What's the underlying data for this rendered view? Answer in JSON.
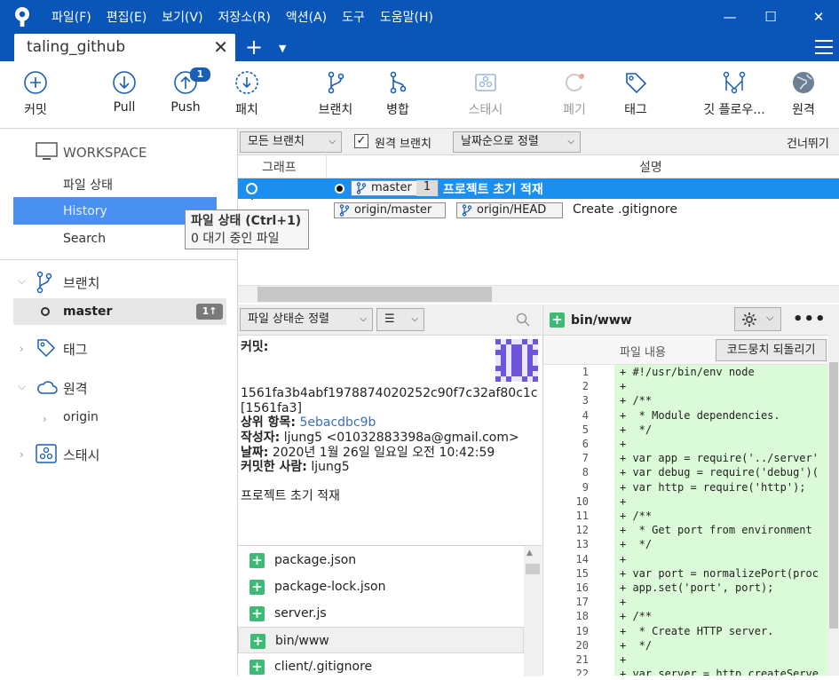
{
  "window": {
    "menu": [
      "파일(F)",
      "편집(E)",
      "보기(V)",
      "저장소(R)",
      "액션(A)",
      "도구",
      "도움말(H)"
    ],
    "controls": {
      "minimize": "—",
      "maximize": "☐",
      "close": "✕"
    }
  },
  "tabs": {
    "active": "taling_github",
    "close": "✕",
    "add": "+",
    "dropdown": "▼"
  },
  "toolbar": {
    "commit": "커밋",
    "pull": "Pull",
    "push": "Push",
    "push_badge": "1",
    "patch": "패치",
    "branch": "브랜치",
    "merge": "병합",
    "stash": "스태시",
    "discard": "폐기",
    "tag": "태그",
    "gitflow": "깃 플로우...",
    "remote": "원격"
  },
  "sidebar": {
    "workspace": "WORKSPACE",
    "workspace_items": [
      "파일 상태",
      "History",
      "Search"
    ],
    "branches_header": "브랜치",
    "branch": "master",
    "branch_ahead": "1↑",
    "tags_header": "태그",
    "remotes_header": "원격",
    "remote": "origin",
    "stash_header": "스태시"
  },
  "tooltip": {
    "title": "파일 상태 (Ctrl+1)",
    "body": "0 대기 중인 파일"
  },
  "history": {
    "filter_branches": "모든 브랜치",
    "remote_branches": "원격 브랜치",
    "remote_branches_checked": true,
    "sort": "날짜순으로 정렬",
    "skip": "건너뛰기",
    "col_graph": "그래프",
    "col_desc": "설명",
    "rows": [
      {
        "refs": [
          "master"
        ],
        "ahead": "1",
        "desc": "프로젝트 초기 적재"
      },
      {
        "refs": [
          "origin/master",
          "origin/HEAD"
        ],
        "desc": "Create .gitignore"
      }
    ]
  },
  "detail": {
    "sort": "파일 상태순 정렬",
    "list_mode": "☰",
    "commit_label": "커밋:",
    "hash": "1561fa3b4abf1978874020252c90f7c32af80c1c",
    "short_hash": "[1561fa3]",
    "parent_label": "상위 항목:",
    "parent": "5ebacdbc9b",
    "author_label": "작성자:",
    "author": "ljung5 <01032883398a@gmail.com>",
    "date_label": "날짜:",
    "date": "2020년 1월 26일 일요일 오전 10:42:59",
    "committer_label": "커밋한 사람:",
    "committer": "ljung5",
    "message": "프로젝트 초기 적재",
    "files": [
      "package.json",
      "package-lock.json",
      "server.js",
      "bin/www",
      "client/.gitignore"
    ]
  },
  "diff": {
    "file": "bin/www",
    "content_label": "파일 내용",
    "revert_hunk": "코드뭉치 되돌리기",
    "lines": [
      "+ #!/usr/bin/env node",
      "+",
      "+ /**",
      "+  * Module dependencies.",
      "+  */",
      "+",
      "+ var app = require('../server'",
      "+ var debug = require('debug')(",
      "+ var http = require('http');",
      "+",
      "+ /**",
      "+  * Get port from environment",
      "+  */",
      "+",
      "+ var port = normalizePort(proc",
      "+ app.set('port', port);",
      "+",
      "+ /**",
      "+  * Create HTTP server.",
      "+  */",
      "+",
      "+ var server = http.createServe"
    ],
    "line_numbers": [
      "1",
      "2",
      "3",
      "4",
      "5",
      "6",
      "7",
      "8",
      "9",
      "10",
      "11",
      "12",
      "13",
      "14",
      "15",
      "16",
      "17",
      "18",
      "19",
      "20",
      "21",
      "22"
    ]
  }
}
